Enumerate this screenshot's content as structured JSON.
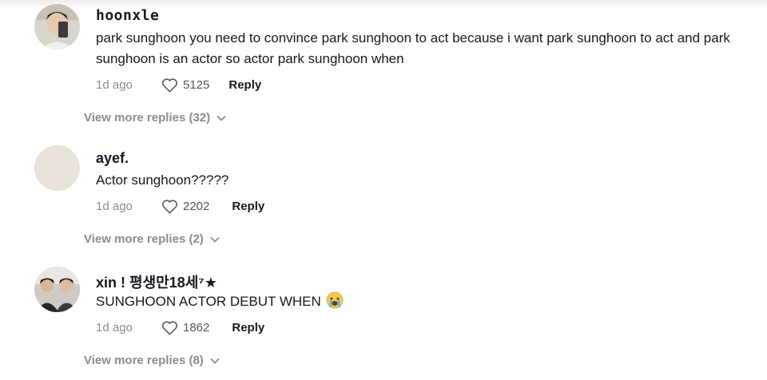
{
  "comments": [
    {
      "username": "hoonxle",
      "text": "park sunghoon you need to convince park sunghoon to act because i want park sunghoon to act and park sunghoon is an actor so actor park sunghoon when",
      "time": "1d ago",
      "likes": "5125",
      "reply_label": "Reply",
      "view_more": "View more replies (32)"
    },
    {
      "username": "ayef.",
      "text": "Actor sunghoon?????",
      "time": "1d ago",
      "likes": "2202",
      "reply_label": "Reply",
      "view_more": "View more replies (2)"
    },
    {
      "username": "xin ! 평생만18세⁷★",
      "text": "SUNGHOON ACTOR DEBUT WHEN",
      "emoji": "crying-face-emoji",
      "time": "1d ago",
      "likes": "1862",
      "reply_label": "Reply",
      "view_more": "View more replies (8)"
    }
  ],
  "colors": {
    "primary_text": "#161823",
    "secondary_text": "#8a8b91",
    "avatar_placeholder": "#e8e2da"
  },
  "icons": {
    "like": "heart-outline-icon",
    "expand": "chevron-down-icon"
  }
}
